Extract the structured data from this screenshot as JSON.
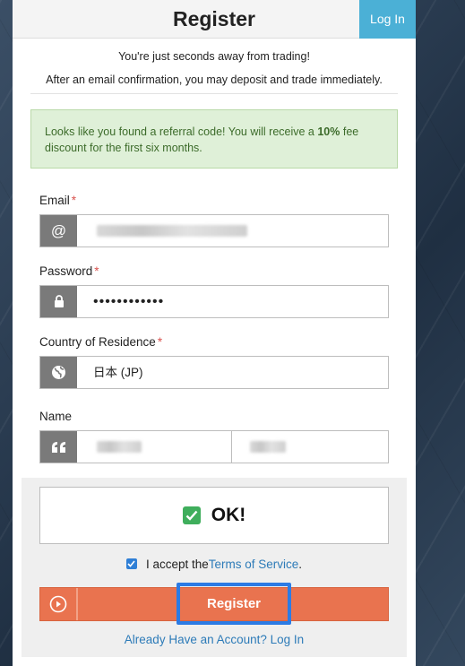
{
  "header": {
    "title": "Register",
    "login_tab": "Log In"
  },
  "intro": {
    "line1": "You're just seconds away from trading!",
    "line2": "After an email confirmation, you may deposit and trade immediately."
  },
  "alert": {
    "text_before": "Looks like you found a referral code! You will receive a ",
    "bold": "10%",
    "text_after": " fee discount for the first six months."
  },
  "form": {
    "email": {
      "label": "Email",
      "required_mark": "*",
      "icon": "at-icon",
      "addon_glyph": "@"
    },
    "password": {
      "label": "Password",
      "required_mark": "*",
      "icon": "lock-icon",
      "value": "••••••••••••"
    },
    "country": {
      "label": "Country of Residence",
      "required_mark": "*",
      "icon": "globe-icon",
      "value": "日本 (JP)"
    },
    "name": {
      "label": "Name",
      "icon": "quote-icon"
    }
  },
  "captcha": {
    "status": "OK!",
    "icon": "check-icon"
  },
  "terms": {
    "prefix": "I accept the ",
    "link": "Terms of Service",
    "suffix": ".",
    "checked": true
  },
  "submit": {
    "label": "Register",
    "icon": "play-circle-icon"
  },
  "footer": {
    "link": "Already Have an Account? Log In"
  },
  "colors": {
    "accent": "#e9734f",
    "login_tab": "#4bb0d6",
    "alert_bg": "#dff0d8",
    "link": "#2d7bb8",
    "highlight": "#2c7be5"
  }
}
